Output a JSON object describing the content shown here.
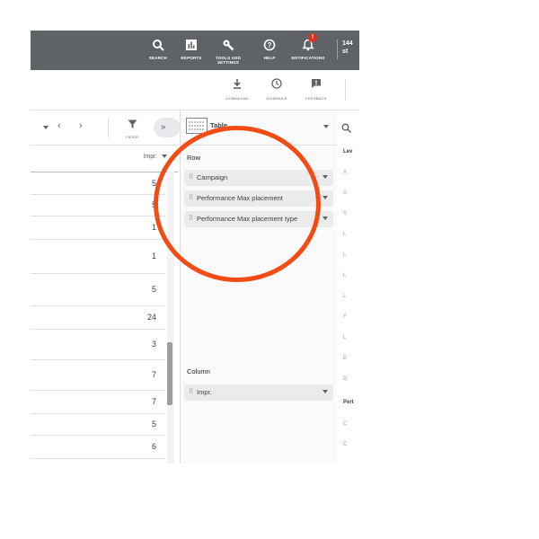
{
  "header": {
    "items": [
      {
        "label": "SEARCH",
        "icon": "search-icon"
      },
      {
        "label": "REPORTS",
        "icon": "reports-icon"
      },
      {
        "label": "TOOLS AND SETTINGS",
        "icon": "wrench-icon"
      },
      {
        "label": "HELP",
        "icon": "help-icon"
      },
      {
        "label": "NOTIFICATIONS",
        "icon": "bell-icon",
        "badge": "!"
      }
    ],
    "account_line1": "144",
    "account_line2": "st"
  },
  "toolbar": {
    "items": [
      {
        "label": "DOWNLOAD",
        "icon": "download-icon"
      },
      {
        "label": "SCHEDULE",
        "icon": "clock-icon"
      },
      {
        "label": "FEEDBACK",
        "icon": "feedback-icon"
      }
    ]
  },
  "table": {
    "filter_label": "FILTER",
    "column_header": "Impr.",
    "rows": [
      "5",
      "5",
      "1",
      "1",
      "5",
      "24",
      "3",
      "7",
      "7",
      "5",
      "6"
    ]
  },
  "config": {
    "view_label": "Table",
    "row_section": "Row",
    "row_chips": [
      "Campaign",
      "Performance Max placement",
      "Performance Max placement type"
    ],
    "column_section": "Column",
    "column_chips": [
      "Impr."
    ]
  },
  "right_panel": {
    "labels": [
      "Lev",
      "A",
      "A",
      "S",
      "L",
      "L",
      "L",
      "L",
      "F",
      "L",
      "E",
      "D",
      "Pert",
      "C",
      "C"
    ]
  },
  "colors": {
    "header_bg": "#5f6368",
    "annotation": "#f24b14",
    "badge": "#d93025"
  }
}
